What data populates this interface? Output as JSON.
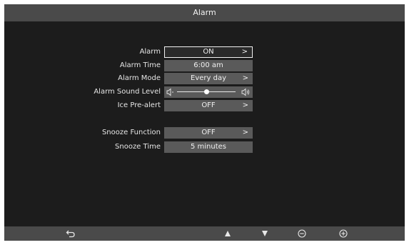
{
  "header": {
    "title": "Alarm"
  },
  "settings": [
    {
      "label": "Alarm",
      "value": "ON",
      "chevron": ">"
    },
    {
      "label": "Alarm Time",
      "value": "6:00 am"
    },
    {
      "label": "Alarm Mode",
      "value": "Every day",
      "chevron": ">"
    },
    {
      "label": "Alarm Sound Level",
      "level": 0.5
    },
    {
      "label": "Ice Pre-alert",
      "value": "OFF",
      "chevron": ">"
    },
    {
      "label": "Snooze Function",
      "value": "OFF",
      "chevron": ">"
    },
    {
      "label": "Snooze Time",
      "value": "5 minutes"
    }
  ],
  "footer": {
    "icons": [
      "back-icon",
      "up-arrow-icon",
      "down-arrow-icon",
      "minus-icon",
      "plus-icon"
    ]
  },
  "colors": {
    "background": "#1c1c1c",
    "bar": "#4a4a4a",
    "field": "#5a5a5a",
    "text": "#e6e6e6"
  }
}
